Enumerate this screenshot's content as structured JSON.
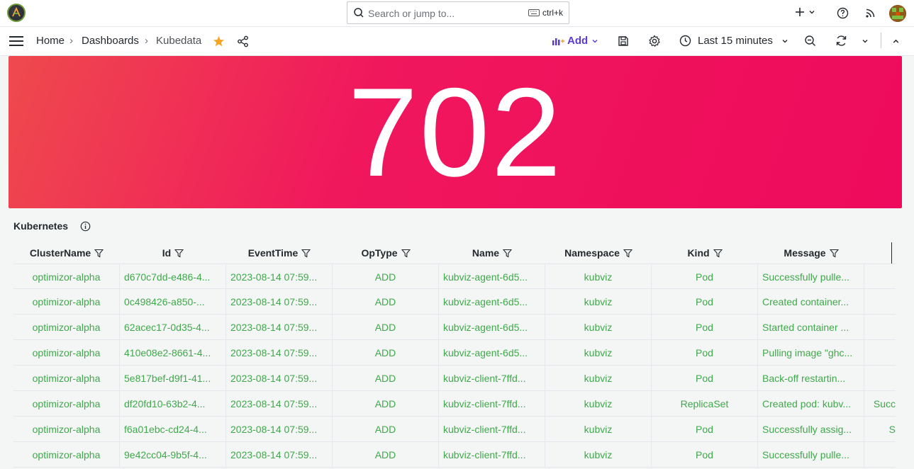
{
  "search": {
    "placeholder": "Search or jump to...",
    "shortcut": "ctrl+k"
  },
  "breadcrumb": {
    "home": "Home",
    "dashboards": "Dashboards",
    "current": "Kubedata"
  },
  "toolbar": {
    "add_label": "Add",
    "time_range": "Last 15 minutes"
  },
  "stat": {
    "value": "702"
  },
  "panel": {
    "title": "Kubernetes"
  },
  "table": {
    "columns": [
      "ClusterName",
      "Id",
      "EventTime",
      "OpType",
      "Name",
      "Namespace",
      "Kind",
      "Message"
    ],
    "rows": [
      [
        "optimizor-alpha",
        "d670c7dd-e486-4...",
        "2023-08-14 07:59...",
        "ADD",
        "kubviz-agent-6d5...",
        "kubviz",
        "Pod",
        "Successfully pulle...",
        ""
      ],
      [
        "optimizor-alpha",
        "0c498426-a850-...",
        "2023-08-14 07:59...",
        "ADD",
        "kubviz-agent-6d5...",
        "kubviz",
        "Pod",
        "Created container...",
        ""
      ],
      [
        "optimizor-alpha",
        "62acec17-0d35-4...",
        "2023-08-14 07:59...",
        "ADD",
        "kubviz-agent-6d5...",
        "kubviz",
        "Pod",
        "Started container ...",
        ""
      ],
      [
        "optimizor-alpha",
        "410e08e2-8661-4...",
        "2023-08-14 07:59...",
        "ADD",
        "kubviz-agent-6d5...",
        "kubviz",
        "Pod",
        "Pulling image \"ghc...",
        ""
      ],
      [
        "optimizor-alpha",
        "5e817bef-d9f1-41...",
        "2023-08-14 07:59...",
        "ADD",
        "kubviz-client-7ffd...",
        "kubviz",
        "Pod",
        "Back-off restartin...",
        ""
      ],
      [
        "optimizor-alpha",
        "df20fd10-63b2-4...",
        "2023-08-14 07:59...",
        "ADD",
        "kubviz-client-7ffd...",
        "kubviz",
        "ReplicaSet",
        "Created pod: kubv...",
        "Succ"
      ],
      [
        "optimizor-alpha",
        "f6a01ebc-cd24-4...",
        "2023-08-14 07:59...",
        "ADD",
        "kubviz-client-7ffd...",
        "kubviz",
        "Pod",
        "Successfully assig...",
        "S"
      ],
      [
        "optimizor-alpha",
        "9e42cc04-9b5f-4...",
        "2023-08-14 07:59...",
        "ADD",
        "kubviz-client-7ffd...",
        "kubviz",
        "Pod",
        "Successfully pulle...",
        ""
      ]
    ]
  },
  "colors": {
    "stat_bg": "#f0175d",
    "cell_text": "#3fa94a",
    "star": "#f5a623"
  }
}
